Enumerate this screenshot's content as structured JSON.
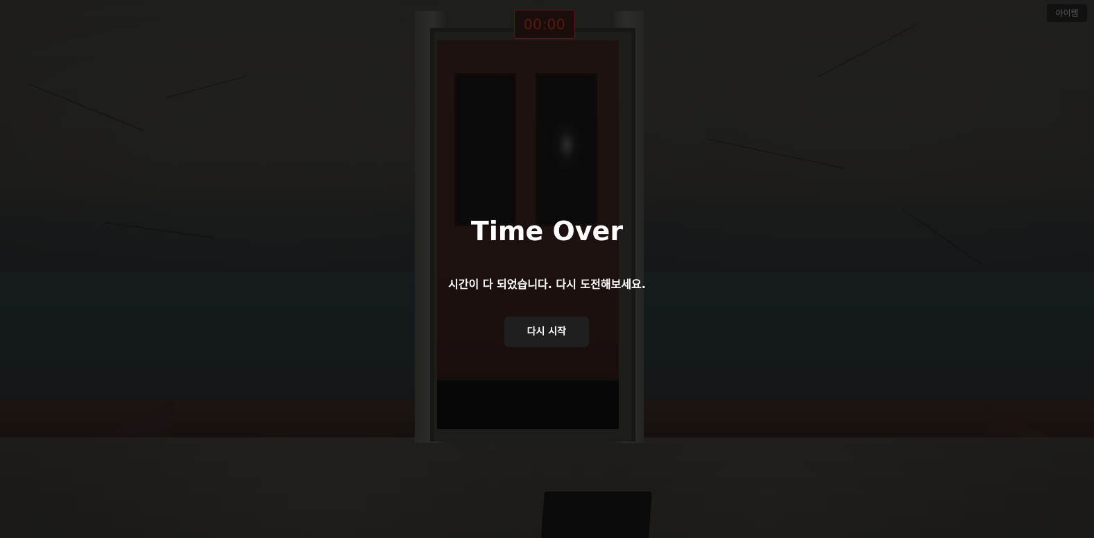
{
  "hud": {
    "timer": "00:00",
    "item_button_label": "아이템"
  },
  "dialog": {
    "title": "Time Over",
    "message": "시간이 다 되었습니다. 다시 도전해보세요.",
    "restart_label": "다시 시작"
  },
  "colors": {
    "overlay": "#000000",
    "timer_text": "#5b1812",
    "button_bg": "#1f1f1f",
    "text": "#ffffff"
  }
}
